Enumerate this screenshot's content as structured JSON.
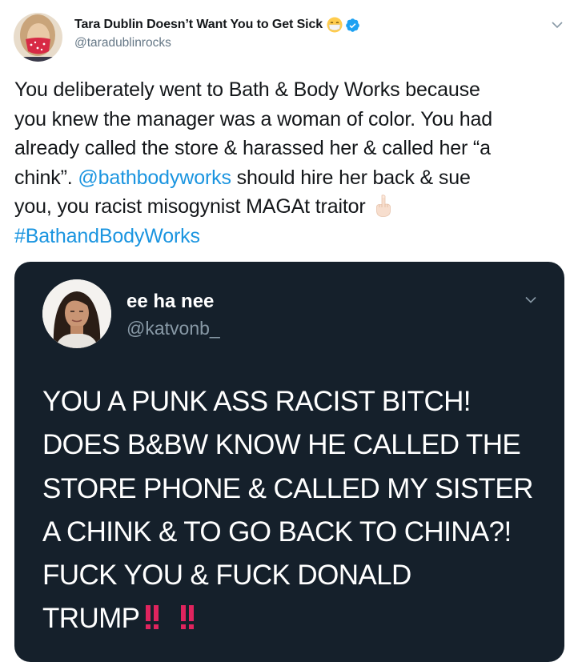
{
  "tweet": {
    "display_name": "Tara Dublin Doesn’t Want You to Get Sick",
    "handle": "@taradublinrocks",
    "icons": {
      "avatar": "user-avatar-red-mask",
      "emoji": "face-with-medical-mask-emoji",
      "verified": "verified-badge-icon",
      "caret": "chevron-down-icon",
      "finger": "middle-finger-emoji"
    },
    "colors": {
      "text": "#14171a",
      "secondary": "#657786",
      "link": "#1b95e0",
      "verified": "#1da1f2"
    },
    "text": {
      "line1": "You deliberately went to Bath & Body Works because",
      "line2": "you knew the manager was a woman of color. You had",
      "line3": "already called the store & harassed her & called her “a",
      "line4a": "chink”. ",
      "mention": "@bathbodyworks",
      "line4b": " should hire her back & sue",
      "line5": "you, you racist misogynist MAGAt traitor",
      "hashtag": "#BathandBodyWorks"
    }
  },
  "quoted_tweet": {
    "display_name": "ee ha nee",
    "handle": "@katvonb_",
    "colors": {
      "background": "#15202b",
      "text": "#ffffff",
      "secondary": "#8899a6",
      "emphasis": "#e0245e"
    },
    "icons": {
      "avatar": "user-avatar-photo",
      "caret": "chevron-down-icon",
      "exclamation": "double-exclamation-emoji"
    },
    "text": {
      "line1": "YOU A PUNK ASS RACIST BITCH!",
      "line2": "DOES B&BW KNOW HE CALLED THE",
      "line3": "STORE PHONE & CALLED MY SISTER",
      "line4": "A CHINK & TO GO BACK TO CHINA?!",
      "line5": "FUCK YOU & FUCK DONALD",
      "line6": "TRUMP"
    }
  }
}
